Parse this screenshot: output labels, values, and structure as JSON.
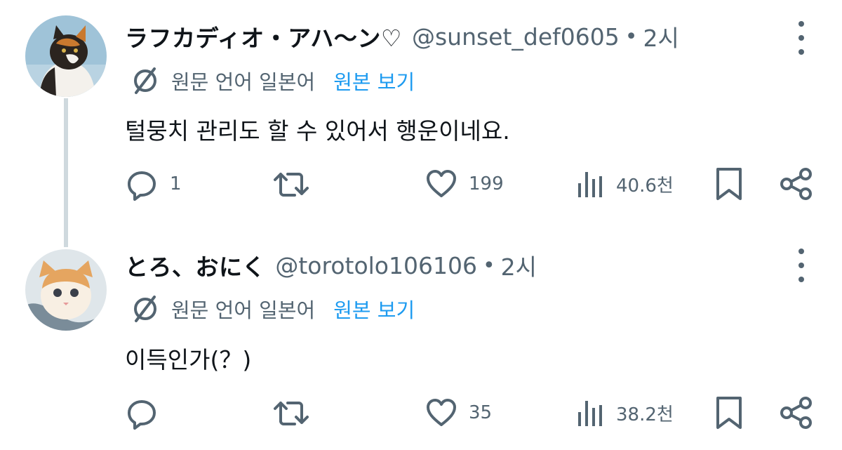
{
  "tweets": [
    {
      "author_name": "ラフカディオ・アハ〜ン♡",
      "handle": "@sunset_def0605",
      "separator": "•",
      "time": "2시",
      "translate_label": "원문 언어 일본어",
      "translate_link": "원본 보기",
      "text": "털뭉치 관리도 할 수 있어서 행운이네요.",
      "replies": "1",
      "retweets": "",
      "likes": "199",
      "views": "40.6천",
      "avatar_icon": "calico-cat-avatar"
    },
    {
      "author_name": "とろ、おにく",
      "handle": "@torotolo106106",
      "separator": "•",
      "time": "2시",
      "translate_label": "원문 언어 일본어",
      "translate_link": "원본 보기",
      "text": "이득인가(？)",
      "replies": "",
      "retweets": "",
      "likes": "35",
      "views": "38.2천",
      "avatar_icon": "orange-kitten-avatar"
    }
  ],
  "icons": {
    "reply": "reply-icon",
    "retweet": "retweet-icon",
    "like": "heart-icon",
    "views": "views-chart-icon",
    "bookmark": "bookmark-icon",
    "share": "share-icon",
    "translate": "translate-icon",
    "more": "more-options-icon"
  },
  "colors": {
    "link": "#1d9bf0",
    "secondary_text": "#536471",
    "thread_line": "#cfd9de"
  }
}
